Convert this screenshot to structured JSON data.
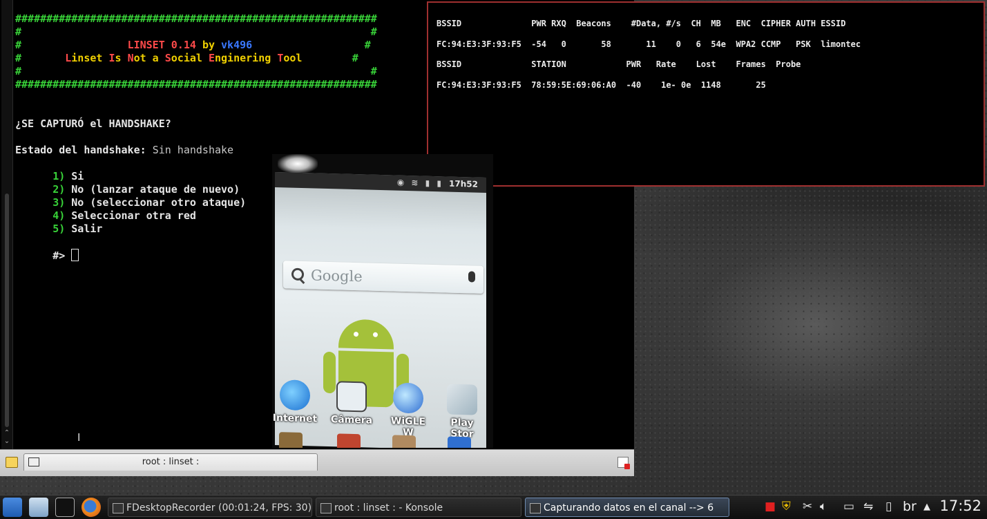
{
  "konsole": {
    "banner": {
      "hash_row": "##########################################################",
      "hash_side": "#",
      "title_prefix": "LINSET 0.14",
      "title_by": "by",
      "title_author": "vk496",
      "subtitle_parts": [
        {
          "text": "L",
          "color": "red"
        },
        {
          "text": "inset ",
          "color": "yellow"
        },
        {
          "text": "I",
          "color": "red"
        },
        {
          "text": "s ",
          "color": "yellow"
        },
        {
          "text": "N",
          "color": "red"
        },
        {
          "text": "ot a ",
          "color": "yellow"
        },
        {
          "text": "S",
          "color": "red"
        },
        {
          "text": "ocial ",
          "color": "yellow"
        },
        {
          "text": "E",
          "color": "red"
        },
        {
          "text": "nginering ",
          "color": "yellow"
        },
        {
          "text": "T",
          "color": "red"
        },
        {
          "text": "ool",
          "color": "yellow"
        }
      ]
    },
    "question": "¿SE CAPTURÓ el HANDSHAKE?",
    "status_label": "Estado del handshake:",
    "status_value": "Sin handshake",
    "options": [
      {
        "num": "1)",
        "label": "Si"
      },
      {
        "num": "2)",
        "label": "No (lanzar ataque de nuevo)"
      },
      {
        "num": "3)",
        "label": "No (seleccionar otro ataque)"
      },
      {
        "num": "4)",
        "label": "Seleccionar otra red"
      },
      {
        "num": "5)",
        "label": "Salir"
      }
    ],
    "prompt": "#>",
    "tab_title": "root : linset :"
  },
  "airodump": {
    "header1": "BSSID              PWR RXQ  Beacons    #Data, #/s  CH  MB   ENC  CIPHER AUTH ESSID",
    "row1": "FC:94:E3:3F:93:F5  -54   0       58       11    0   6  54e  WPA2 CCMP   PSK  limontec",
    "header2": "BSSID              STATION            PWR   Rate    Lost    Frames  Probe",
    "row2": "FC:94:E3:3F:93:F5  78:59:5E:69:06:A0  -40    1e- 0e  1148       25"
  },
  "phone": {
    "time": "17h52",
    "search_text": "Google",
    "apps": [
      "Internet",
      "Câmera",
      "WiGLE W",
      "Play Stor"
    ]
  },
  "panel": {
    "tasks": [
      {
        "label": "FDesktopRecorder (00:01:24, FPS: 30)",
        "state": "open"
      },
      {
        "label": "root : linset :  - Konsole",
        "state": "open"
      },
      {
        "label": "Capturando datos en el canal --> 6",
        "state": "active"
      }
    ],
    "keyboard_layout": "br",
    "clock": "17:52"
  },
  "colors": {
    "hash_green": "#38d138",
    "title_red": "#ff4a4a",
    "subtitle_yellow": "#f0d000",
    "author_blue": "#3a78ff",
    "airodump_border": "#a03030"
  }
}
